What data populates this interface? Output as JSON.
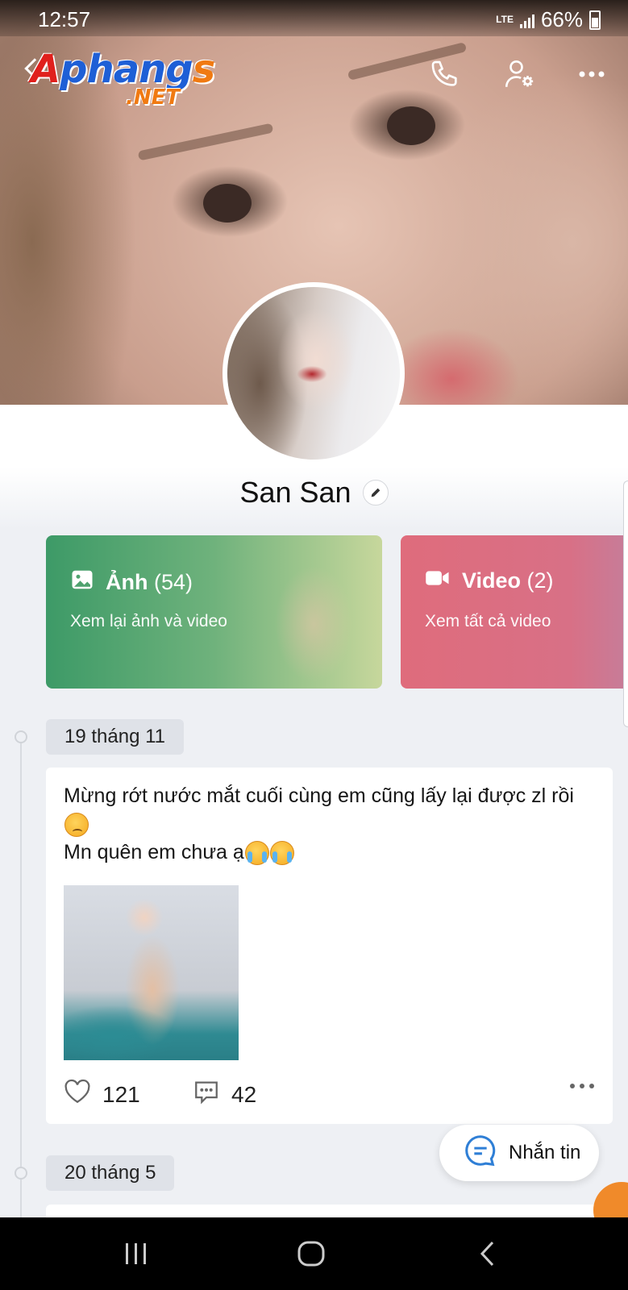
{
  "status_bar": {
    "time": "12:57",
    "network": "LTE",
    "battery": "66%"
  },
  "watermark": {
    "main": "Aphangs",
    "suffix": ".NET"
  },
  "profile": {
    "name": "San San"
  },
  "media": {
    "photos": {
      "label": "Ảnh",
      "count": "(54)",
      "subtitle": "Xem lại ảnh và video"
    },
    "videos": {
      "label": "Video",
      "count": "(2)",
      "subtitle": "Xem tất cả video"
    }
  },
  "timeline": [
    {
      "date": "19 tháng 11",
      "text_line1": "Mừng rớt nước mắt cuối cùng em cũng lấy lại được zl rồi",
      "text_line2": "Mn quên em chưa ạ",
      "likes": "121",
      "comments": "42"
    },
    {
      "date": "20 tháng 5"
    }
  ],
  "fab": {
    "label": "Nhắn tin"
  },
  "colors": {
    "photos_card": "#3d9a67",
    "videos_card": "#df6c7c",
    "message_icon": "#2f7fd6",
    "nav_bar": "#000000"
  },
  "icons": [
    "back-icon",
    "phone-icon",
    "user-settings-icon",
    "more-icon",
    "edit-icon",
    "image-icon",
    "video-camera-icon",
    "heart-icon",
    "comment-icon",
    "message-icon",
    "recents-icon",
    "home-icon",
    "nav-back-icon"
  ]
}
